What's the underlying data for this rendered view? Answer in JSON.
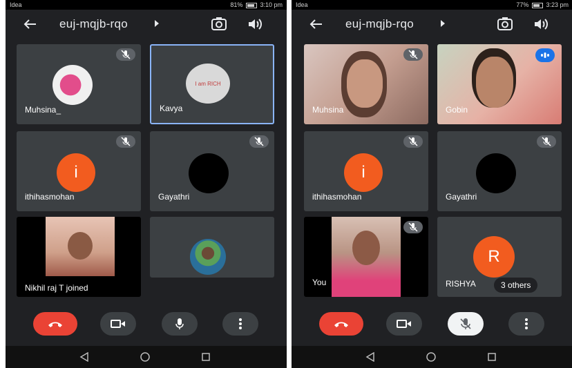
{
  "left": {
    "status": {
      "carrier": "Idea",
      "battery": "81%",
      "time": "3:10 pm"
    },
    "meeting": {
      "code": "euj-mqjb-rqo"
    },
    "tiles": [
      {
        "name": "Muhsina_"
      },
      {
        "name": "Kavya",
        "avatar_text": "I am RICH"
      },
      {
        "name": "ithihasmohan",
        "initial": "i"
      },
      {
        "name": "Gayathri"
      },
      {
        "name": "Nikhil raj T joined"
      },
      {
        "name": ""
      }
    ]
  },
  "right": {
    "status": {
      "carrier": "Idea",
      "battery": "77%",
      "time": "3:23 pm"
    },
    "meeting": {
      "code": "euj-mqjb-rqo"
    },
    "tiles": [
      {
        "name": "Muhsina"
      },
      {
        "name": "Gobin"
      },
      {
        "name": "ithihasmohan",
        "initial": "i"
      },
      {
        "name": "Gayathri"
      },
      {
        "name": "You"
      },
      {
        "name": "RISHYA",
        "initial": "R",
        "others": "3 others"
      }
    ]
  },
  "icons": {
    "back": "back-arrow-icon",
    "flip": "flip-camera-icon",
    "speaker": "speaker-icon",
    "mute": "mic-off-icon",
    "end_call": "end-call-icon",
    "camera": "camera-icon",
    "mic": "mic-icon",
    "more": "more-vert-icon"
  },
  "colors": {
    "background": "#202124",
    "tile": "#3c4043",
    "accent_red": "#ea4335",
    "avatar_orange": "#f25c1f",
    "speaking_blue": "#1a73e8",
    "active_border": "#8ab4f8"
  }
}
